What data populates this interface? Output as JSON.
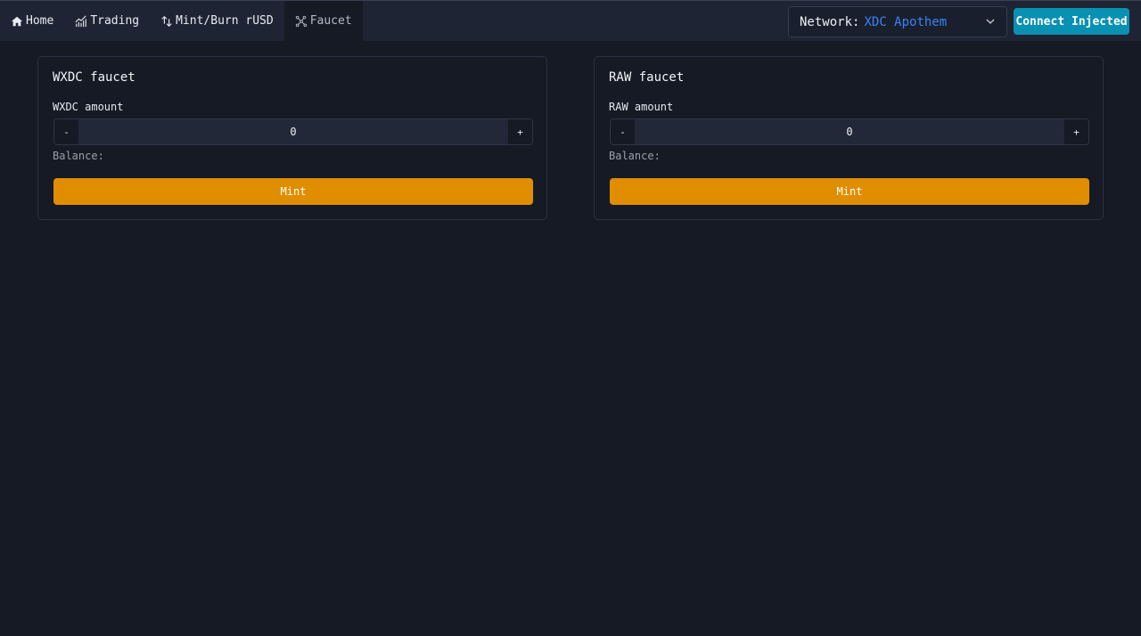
{
  "nav": {
    "items": [
      {
        "label": "Home",
        "icon": "home-icon"
      },
      {
        "label": "Trading",
        "icon": "chart-icon"
      },
      {
        "label": "Mint/Burn rUSD",
        "icon": "swap-arrows-icon"
      },
      {
        "label": "Faucet",
        "icon": "faucet-icon",
        "active": true
      }
    ]
  },
  "network": {
    "label": "Network:",
    "value": "XDC Apothem"
  },
  "connect": {
    "label": "Connect Injected"
  },
  "faucets": [
    {
      "title": "WXDC faucet",
      "amount_label": "WXDC amount",
      "amount_value": "0",
      "minus": "-",
      "plus": "+",
      "balance_label": "Balance:",
      "button": "Mint"
    },
    {
      "title": "RAW faucet",
      "amount_label": "RAW amount",
      "amount_value": "0",
      "minus": "-",
      "plus": "+",
      "balance_label": "Balance:",
      "button": "Mint"
    }
  ],
  "colors": {
    "background": "#161a25",
    "topbar": "#1f2434",
    "accent_network": "#3b82f6",
    "connect_button": "#0891b2",
    "mint_button": "#e08e00"
  }
}
